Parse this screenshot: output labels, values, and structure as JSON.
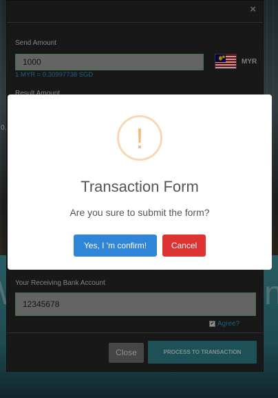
{
  "background": {
    "left_fragment": "W",
    "right_fragment": "n?",
    "side_text": "0."
  },
  "form": {
    "close_icon": "×",
    "send_amount_label": "Send Amount",
    "send_amount_value": "1000",
    "rate_text": "1 MYR = 0.30997738 SGD",
    "currency_code": "MYR",
    "flag_icon": "malaysia-flag-icon",
    "result_amount_label": "Result Amount",
    "receiving_account_label": "Your Receiving Bank Account",
    "receiving_account_value": "12345678",
    "agree_label": "Agree?",
    "agree_checked": true,
    "close_button": "Close",
    "process_button": "PROCESS TO TRANSACTION"
  },
  "dialog": {
    "icon": "warning-icon",
    "icon_glyph": "!",
    "title": "Transaction Form",
    "message": "Are you sure to submit the form?",
    "confirm_button": "Yes, I 'm confirm!",
    "cancel_button": "Cancel",
    "colors": {
      "confirm": "#3085d6",
      "cancel": "#dd3333",
      "warning": "#f5b97d"
    }
  }
}
